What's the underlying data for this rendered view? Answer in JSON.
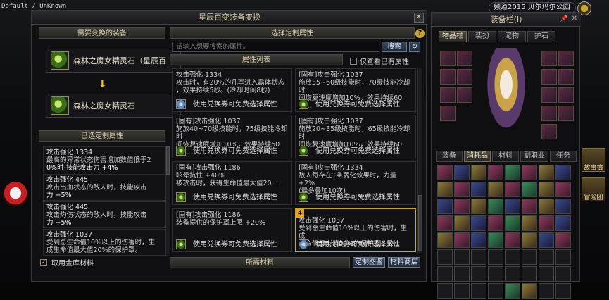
{
  "system": {
    "label": "Default / UnKnown"
  },
  "channel": {
    "label": "频道2015 贝尔玛尔公园"
  },
  "window": {
    "title": "星辰百变装备变换",
    "left": {
      "header": "需要变换的装备",
      "source_item": "森林之魔女精灵石（星辰百",
      "target_item": "森林之魔女精灵石",
      "selected_header": "已选定制属性",
      "selected": [
        {
          "title": "攻击强化 1334",
          "line1": "最高的异常状态伤害增加数值低于2",
          "line2": "0%时-技能攻击力 +4%"
        },
        {
          "title": "攻击强化 445",
          "line1": "攻击出血状态的敌人时，技能攻击",
          "line2": "力 +5%"
        },
        {
          "title": "攻击强化 445",
          "line1": "攻击灼伤状态的敌人时，技能攻击",
          "line2": "力 +5%"
        },
        {
          "title": "攻击强化 1037",
          "line1": "受到总生命值10%以上的伤害时，生",
          "line2": "成生命值最大值20%的保护罩。"
        }
      ],
      "use_vault": "取用金库材料"
    },
    "right": {
      "header": "选择定制属性",
      "search_placeholder": "请输入想要搜索的属性。",
      "search_btn": "搜索",
      "list_title": "属性列表",
      "owned_only": "仅查看已有属性",
      "use_label": "使用兑换券可免费选择属性",
      "cards": [
        {
          "l1": "攻击强化 1334",
          "l2": "攻击时，有20%的几率进入霸体状态",
          "l3": "，效果持续5秒。(冷却时间8秒)"
        },
        {
          "l1": "[固有]攻击强化 1037",
          "l2": "施放35~60级技能时，70级技能冷却时",
          "l3": "间恢复速度增加10%，效果持续60秒..."
        },
        {
          "l1": "[固有]攻击强化 1037",
          "l2": "施放40~70级技能时，75级技能冷却时",
          "l3": "间恢复速度增加10%，效果持续60秒..."
        },
        {
          "l1": "[固有]攻击强化 1037",
          "l2": "施放20~35级技能时，65级技能冷却时",
          "l3": "间恢复速度增加10%，效果持续60秒..."
        },
        {
          "l1": "[固有]攻击强化 1186",
          "l2": "眩晕抗性 +40%",
          "l3": "被攻击时，获得生命值最大值20..."
        },
        {
          "l1": "[固有]攻击强化 1334",
          "l2": "敌人每存在1条弱化效果时，力量 +2%",
          "l3": "(最多叠加10次)"
        },
        {
          "l1": "[固有]攻击强化 1186",
          "l2": "装备提供的保护罩上限 +20%",
          "l3": ""
        },
        {
          "l1": "攻击强化 1037",
          "l2": "受到总生命值10%以上的伤害时，生成",
          "l3": "生命值最大值20%的保护罩，效..."
        }
      ],
      "selected_badge": "4",
      "materials_header": "所需材料",
      "custom_btn": "定制图鉴",
      "shop_btn": "材料商店"
    }
  },
  "equipment": {
    "title": "装备栏(I)",
    "top_tabs": [
      "物品栏",
      "装扮",
      "宠物",
      "护石"
    ],
    "bottom_tabs": [
      "装备",
      "消耗品",
      "材料",
      "副职业",
      "任务"
    ]
  },
  "side": {
    "btn1": "故事簿",
    "btn2": "冒险团"
  }
}
